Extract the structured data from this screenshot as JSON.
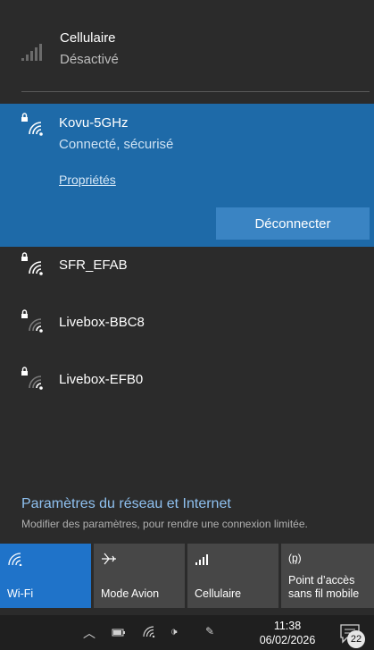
{
  "cellular": {
    "name": "Cellulaire",
    "status": "Désactivé"
  },
  "connected_network": {
    "name": "Kovu-5GHz",
    "status": "Connecté, sécurisé",
    "properties_link": "Propriétés",
    "disconnect_button": "Déconnecter"
  },
  "networks": [
    {
      "name": "SFR_EFAB",
      "signal": "strong"
    },
    {
      "name": "Livebox-BBC8",
      "signal": "weak"
    },
    {
      "name": "Livebox-EFB0",
      "signal": "weak"
    }
  ],
  "settings": {
    "link": "Paramètres du réseau et Internet",
    "subtitle": "Modifier des paramètres, pour rendre une connexion limitée."
  },
  "quick_actions": [
    {
      "label": "Wi-Fi",
      "icon": "wifi-icon",
      "active": true
    },
    {
      "label": "Mode Avion",
      "icon": "airplane-icon",
      "active": false
    },
    {
      "label": "Cellulaire",
      "icon": "cellular-icon",
      "active": false
    },
    {
      "label": "Point d’accès sans fil mobile",
      "line1": "Point d’accès",
      "line2": "sans fil mobile",
      "icon": "hotspot-icon",
      "active": false
    }
  ],
  "taskbar": {
    "time": "11:38",
    "date": "06/02/2026",
    "notification_count": "22"
  },
  "colors": {
    "panel_bg": "#2b2b2b",
    "connected_bg": "#1e6aa8",
    "accent": "#1f73c9",
    "link": "#8fc1f0"
  }
}
